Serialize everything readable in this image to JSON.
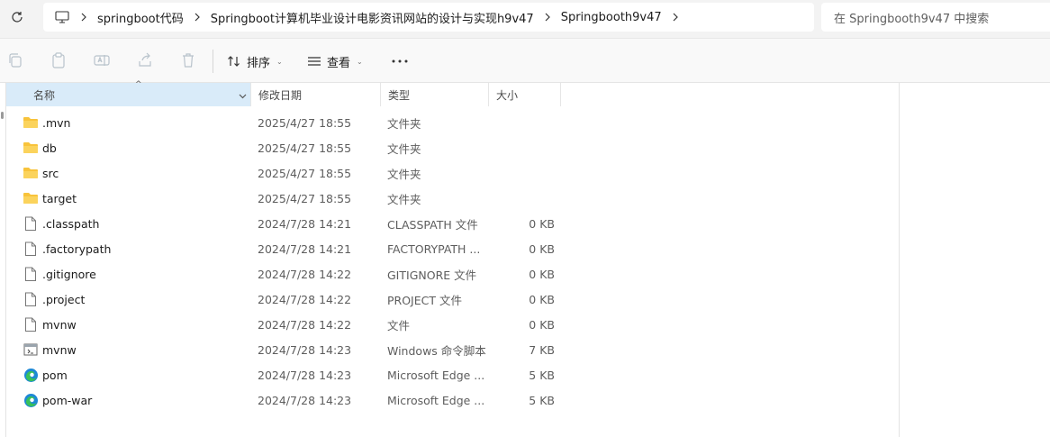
{
  "address": {
    "crumbs": [
      "springboot代码",
      "Springboot计算机毕业设计电影资讯网站的设计与实现h9v47",
      "Springbooth9v47"
    ],
    "search_placeholder": "在 Springbooth9v47 中搜索"
  },
  "toolbar": {
    "sort_label": "排序",
    "view_label": "查看",
    "icons": [
      "copy-icon",
      "paste-icon",
      "rename-icon",
      "share-icon",
      "delete-icon"
    ]
  },
  "columns": {
    "name": "名称",
    "date": "修改日期",
    "type": "类型",
    "size": "大小"
  },
  "files": [
    {
      "name": ".mvn",
      "date": "2025/4/27 18:55",
      "type": "文件夹",
      "size": "",
      "icon": "folder"
    },
    {
      "name": "db",
      "date": "2025/4/27 18:55",
      "type": "文件夹",
      "size": "",
      "icon": "folder"
    },
    {
      "name": "src",
      "date": "2025/4/27 18:55",
      "type": "文件夹",
      "size": "",
      "icon": "folder"
    },
    {
      "name": "target",
      "date": "2025/4/27 18:55",
      "type": "文件夹",
      "size": "",
      "icon": "folder"
    },
    {
      "name": ".classpath",
      "date": "2024/7/28 14:21",
      "type": "CLASSPATH 文件",
      "size": "0 KB",
      "icon": "file"
    },
    {
      "name": ".factorypath",
      "date": "2024/7/28 14:21",
      "type": "FACTORYPATH ...",
      "size": "0 KB",
      "icon": "file"
    },
    {
      "name": ".gitignore",
      "date": "2024/7/28 14:22",
      "type": "GITIGNORE 文件",
      "size": "0 KB",
      "icon": "file"
    },
    {
      "name": ".project",
      "date": "2024/7/28 14:22",
      "type": "PROJECT 文件",
      "size": "0 KB",
      "icon": "file"
    },
    {
      "name": "mvnw",
      "date": "2024/7/28 14:22",
      "type": "文件",
      "size": "0 KB",
      "icon": "file"
    },
    {
      "name": "mvnw",
      "date": "2024/7/28 14:23",
      "type": "Windows 命令脚本",
      "size": "7 KB",
      "icon": "script"
    },
    {
      "name": "pom",
      "date": "2024/7/28 14:23",
      "type": "Microsoft Edge ...",
      "size": "5 KB",
      "icon": "edge"
    },
    {
      "name": "pom-war",
      "date": "2024/7/28 14:23",
      "type": "Microsoft Edge ...",
      "size": "5 KB",
      "icon": "edge"
    }
  ],
  "colors": {
    "folder": "#f8c33b",
    "header_selected": "#d9ebf9",
    "edge_blue": "#1e88d6",
    "edge_green": "#38c05a"
  }
}
